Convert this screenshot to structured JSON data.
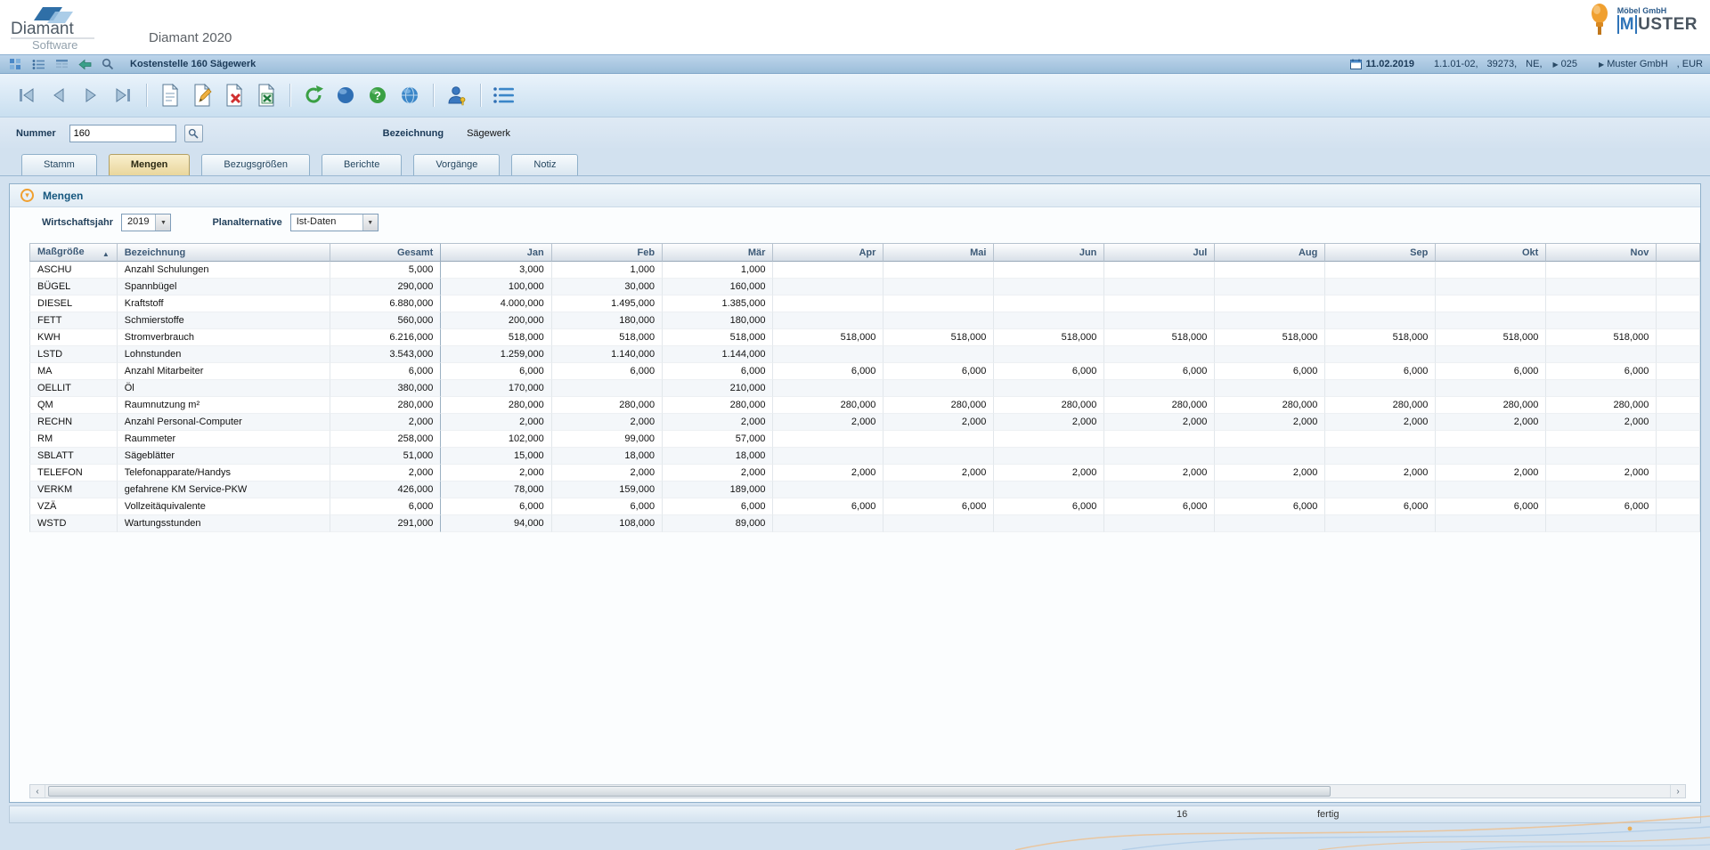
{
  "app": {
    "logo_line1": "Diamant",
    "logo_line2": "Software",
    "title": "Diamant 2020"
  },
  "customer_logo": {
    "line1": "Möbel GmbH",
    "m": "M",
    "rest": "USTER"
  },
  "title_bar": {
    "context": "Kostenstelle 160 Sägewerk",
    "date": "11.02.2019",
    "version": "1.1.01-02,",
    "number": "39273,",
    "region": "NE,",
    "site": "025",
    "company": "Muster GmbH",
    "currency": ",  EUR"
  },
  "form": {
    "nummer_label": "Nummer",
    "nummer_value": "160",
    "bezeichnung_label": "Bezeichnung",
    "bezeichnung_value": "Sägewerk"
  },
  "tabs": [
    {
      "label": "Stamm",
      "active": false
    },
    {
      "label": "Mengen",
      "active": true
    },
    {
      "label": "Bezugsgrößen",
      "active": false
    },
    {
      "label": "Berichte",
      "active": false
    },
    {
      "label": "Vorgänge",
      "active": false
    },
    {
      "label": "Notiz",
      "active": false
    }
  ],
  "section": {
    "title": "Mengen",
    "wirtschaftsjahr_label": "Wirtschaftsjahr",
    "wirtschaftsjahr_value": "2019",
    "planalternative_label": "Planalternative",
    "planalternative_value": "Ist-Daten"
  },
  "icons": {
    "sort_asc": "▲",
    "section_chevron": "▾",
    "dropdown_arrow": "▼",
    "scroll_left": "◄",
    "scroll_right": "►",
    "marker": "▶"
  },
  "table": {
    "sorted_by": "Maßgröße",
    "columns": [
      "Maßgröße",
      "Bezeichnung",
      "Gesamt",
      "Jan",
      "Feb",
      "Mär",
      "Apr",
      "Mai",
      "Jun",
      "Jul",
      "Aug",
      "Sep",
      "Okt",
      "Nov"
    ],
    "rows": [
      {
        "code": "ASCHU",
        "name": "Anzahl Schulungen",
        "values": [
          "5,000",
          "3,000",
          "1,000",
          "1,000",
          "",
          "",
          "",
          "",
          "",
          "",
          "",
          ""
        ]
      },
      {
        "code": "BÜGEL",
        "name": "Spannbügel",
        "values": [
          "290,000",
          "100,000",
          "30,000",
          "160,000",
          "",
          "",
          "",
          "",
          "",
          "",
          "",
          ""
        ]
      },
      {
        "code": "DIESEL",
        "name": "Kraftstoff",
        "values": [
          "6.880,000",
          "4.000,000",
          "1.495,000",
          "1.385,000",
          "",
          "",
          "",
          "",
          "",
          "",
          "",
          ""
        ]
      },
      {
        "code": "FETT",
        "name": "Schmierstoffe",
        "values": [
          "560,000",
          "200,000",
          "180,000",
          "180,000",
          "",
          "",
          "",
          "",
          "",
          "",
          "",
          ""
        ]
      },
      {
        "code": "KWH",
        "name": "Stromverbrauch",
        "values": [
          "6.216,000",
          "518,000",
          "518,000",
          "518,000",
          "518,000",
          "518,000",
          "518,000",
          "518,000",
          "518,000",
          "518,000",
          "518,000",
          "518,000"
        ]
      },
      {
        "code": "LSTD",
        "name": "Lohnstunden",
        "values": [
          "3.543,000",
          "1.259,000",
          "1.140,000",
          "1.144,000",
          "",
          "",
          "",
          "",
          "",
          "",
          "",
          ""
        ]
      },
      {
        "code": "MA",
        "name": "Anzahl Mitarbeiter",
        "values": [
          "6,000",
          "6,000",
          "6,000",
          "6,000",
          "6,000",
          "6,000",
          "6,000",
          "6,000",
          "6,000",
          "6,000",
          "6,000",
          "6,000"
        ]
      },
      {
        "code": "OELLIT",
        "name": "Öl",
        "values": [
          "380,000",
          "170,000",
          "",
          "210,000",
          "",
          "",
          "",
          "",
          "",
          "",
          "",
          ""
        ]
      },
      {
        "code": "QM",
        "name": "Raumnutzung m²",
        "values": [
          "280,000",
          "280,000",
          "280,000",
          "280,000",
          "280,000",
          "280,000",
          "280,000",
          "280,000",
          "280,000",
          "280,000",
          "280,000",
          "280,000"
        ]
      },
      {
        "code": "RECHN",
        "name": "Anzahl Personal-Computer",
        "values": [
          "2,000",
          "2,000",
          "2,000",
          "2,000",
          "2,000",
          "2,000",
          "2,000",
          "2,000",
          "2,000",
          "2,000",
          "2,000",
          "2,000"
        ]
      },
      {
        "code": "RM",
        "name": "Raummeter",
        "values": [
          "258,000",
          "102,000",
          "99,000",
          "57,000",
          "",
          "",
          "",
          "",
          "",
          "",
          "",
          ""
        ]
      },
      {
        "code": "SBLATT",
        "name": "Sägeblätter",
        "values": [
          "51,000",
          "15,000",
          "18,000",
          "18,000",
          "",
          "",
          "",
          "",
          "",
          "",
          "",
          ""
        ]
      },
      {
        "code": "TELEFON",
        "name": "Telefonapparate/Handys",
        "values": [
          "2,000",
          "2,000",
          "2,000",
          "2,000",
          "2,000",
          "2,000",
          "2,000",
          "2,000",
          "2,000",
          "2,000",
          "2,000",
          "2,000"
        ]
      },
      {
        "code": "VERKM",
        "name": "gefahrene KM Service-PKW",
        "values": [
          "426,000",
          "78,000",
          "159,000",
          "189,000",
          "",
          "",
          "",
          "",
          "",
          "",
          "",
          ""
        ]
      },
      {
        "code": "VZÄ",
        "name": "Vollzeitäquivalente",
        "values": [
          "6,000",
          "6,000",
          "6,000",
          "6,000",
          "6,000",
          "6,000",
          "6,000",
          "6,000",
          "6,000",
          "6,000",
          "6,000",
          "6,000"
        ]
      },
      {
        "code": "WSTD",
        "name": "Wartungsstunden",
        "values": [
          "291,000",
          "94,000",
          "108,000",
          "89,000",
          "",
          "",
          "",
          "",
          "",
          "",
          "",
          ""
        ]
      }
    ]
  },
  "status": {
    "count": "16",
    "state": "fertig"
  },
  "colors": {
    "accent_orange": "#f0a030",
    "title_bar_blue": "#9cbeda",
    "active_tab_tan": "#e9d69c",
    "header_text_blue": "#3d5a77"
  }
}
